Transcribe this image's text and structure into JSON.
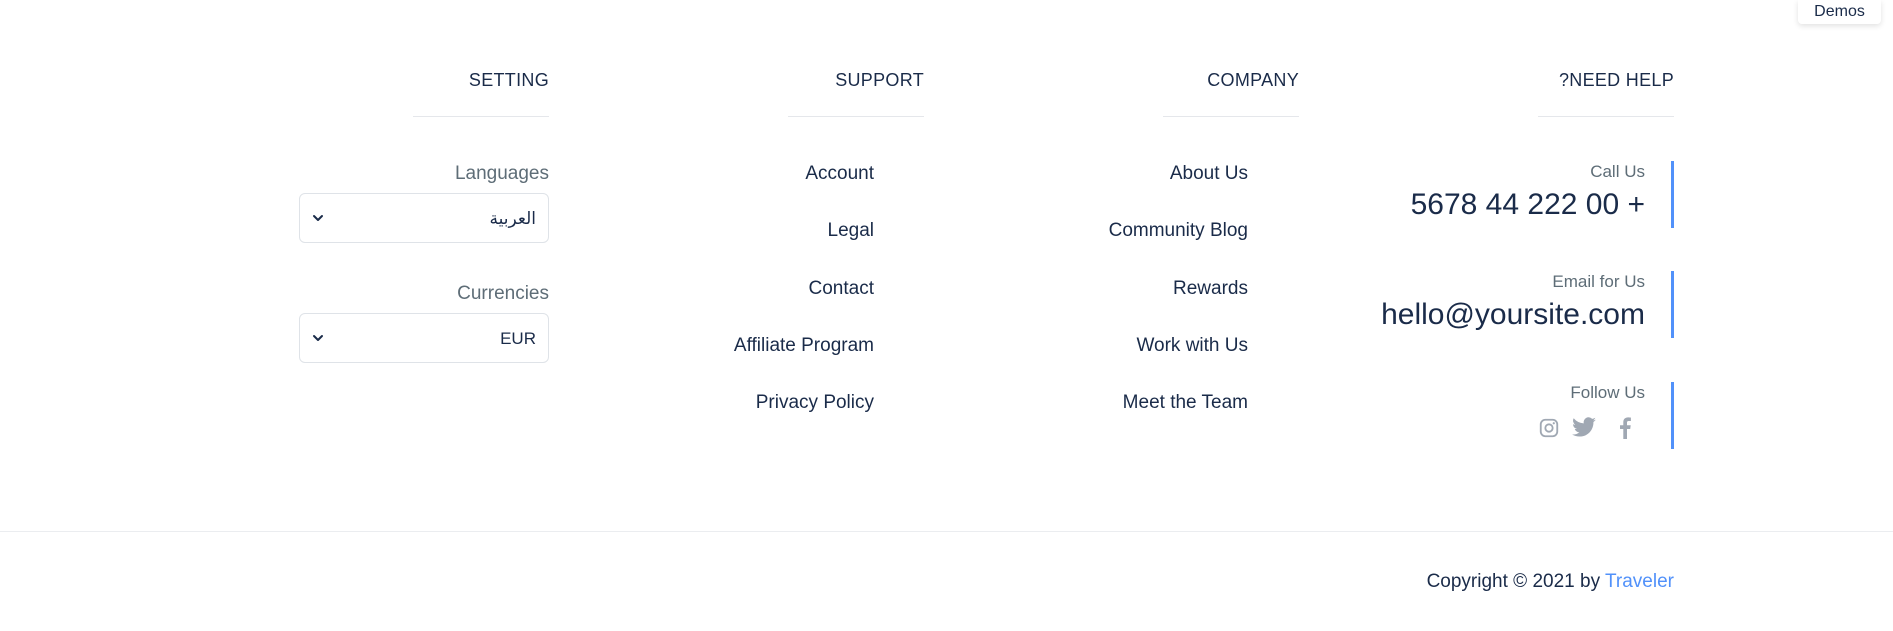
{
  "demos_label": "Demos",
  "columns": {
    "setting": {
      "title": "SETTING",
      "languages_label": "Languages",
      "language_value": "العربية",
      "currencies_label": "Currencies",
      "currency_value": "EUR"
    },
    "support": {
      "title": "SUPPORT",
      "links": [
        "Account",
        "Legal",
        "Contact",
        "Affiliate Program",
        "Privacy Policy"
      ]
    },
    "company": {
      "title": "COMPANY",
      "links": [
        "About Us",
        "Community Blog",
        "Rewards",
        "Work with Us",
        "Meet the Team"
      ]
    },
    "help": {
      "title": "?NEED HELP",
      "call_label": "Call Us",
      "phone": "5678 44 222 00 +",
      "email_label": "Email for Us",
      "email": "hello@yoursite.com",
      "follow_label": "Follow Us",
      "social_icons": [
        "instagram-icon",
        "twitter-icon",
        "facebook-icon"
      ]
    }
  },
  "footer": {
    "copyright_prefix": "Copyright © 2021 by",
    "brand": "Traveler"
  },
  "colors": {
    "text": "#1a2b49",
    "muted": "#5e6d77",
    "accent": "#5191fa",
    "icon": "#a0a8b3"
  }
}
